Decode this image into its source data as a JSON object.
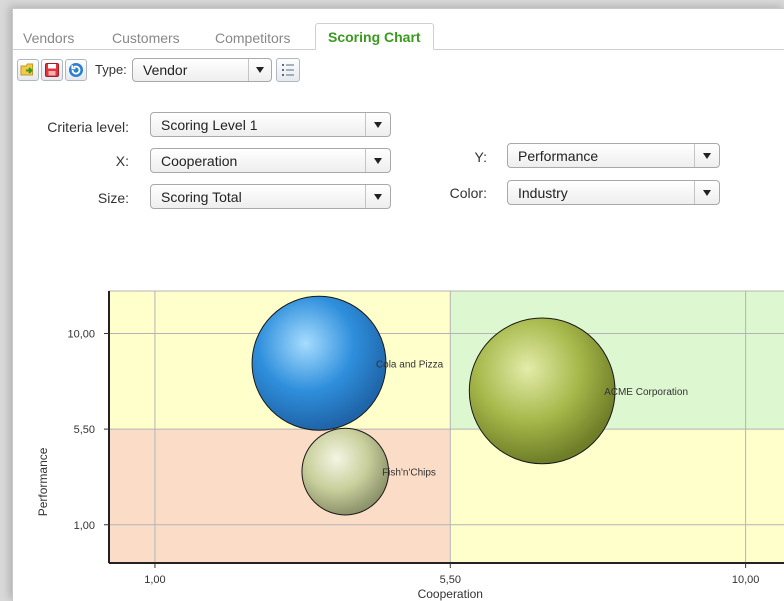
{
  "tabs": [
    {
      "label": "Vendors",
      "active": false
    },
    {
      "label": "Customers",
      "active": false
    },
    {
      "label": "Competitors",
      "active": false
    },
    {
      "label": "Scoring Chart",
      "active": true
    }
  ],
  "toolbar": {
    "type_label": "Type:",
    "type_value": "Vendor",
    "icons": [
      "export-icon",
      "save-icon",
      "refresh-icon",
      "list-icon"
    ]
  },
  "form": {
    "criteria_label": "Criteria level:",
    "criteria_value": "Scoring Level 1",
    "x_label": "X:",
    "x_value": "Cooperation",
    "size_label": "Size:",
    "size_value": "Scoring Total",
    "y_label": "Y:",
    "y_value": "Performance",
    "color_label": "Color:",
    "color_value": "Industry"
  },
  "colors": {
    "accent": "#3a9a1e",
    "zone_top_left": "#ffffcc",
    "zone_top_right": "#ddf7d0",
    "zone_bottom_left": "#fbdcc6",
    "zone_bottom_right": "#ffffcc"
  },
  "chart_data": {
    "type": "scatter",
    "xlabel": "Cooperation",
    "ylabel": "Performance",
    "xlim": [
      0.3,
      10.6
    ],
    "ylim": [
      -0.8,
      12.0
    ],
    "xticks": [
      {
        "v": 1.0,
        "label": "1,00"
      },
      {
        "v": 5.5,
        "label": "5,50"
      },
      {
        "v": 10.0,
        "label": "10,00"
      }
    ],
    "yticks": [
      {
        "v": 1.0,
        "label": "1,00"
      },
      {
        "v": 5.5,
        "label": "5,50"
      },
      {
        "v": 10.0,
        "label": "10,00"
      }
    ],
    "grid": true,
    "points": [
      {
        "name": "Cola and Pizza",
        "x": 3.5,
        "y": 8.6,
        "size": 3.4,
        "color": "#2f8fdc"
      },
      {
        "name": "ACME Corporation",
        "x": 6.9,
        "y": 7.3,
        "size": 3.7,
        "color": "#a6b84a"
      },
      {
        "name": "Fish'n'Chips",
        "x": 3.9,
        "y": 3.5,
        "size": 2.2,
        "color": "#c9cf9c"
      }
    ]
  }
}
